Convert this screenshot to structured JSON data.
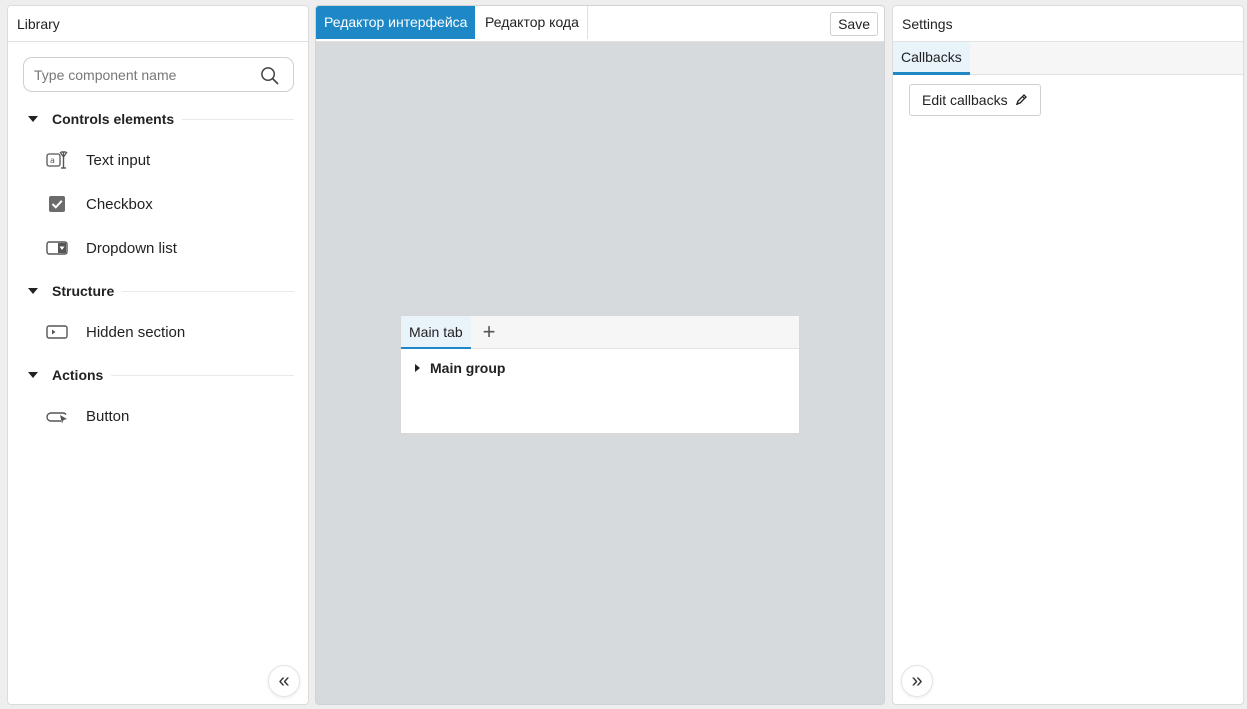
{
  "library": {
    "title": "Library",
    "search": {
      "placeholder": "Type component name",
      "value": ""
    },
    "groups": [
      {
        "title": "Controls elements",
        "items": [
          {
            "label": "Text input",
            "icon": "text-input-icon"
          },
          {
            "label": "Checkbox",
            "icon": "checkbox-icon"
          },
          {
            "label": "Dropdown list",
            "icon": "dropdown-icon"
          }
        ]
      },
      {
        "title": "Structure",
        "items": [
          {
            "label": "Hidden section",
            "icon": "hidden-section-icon"
          }
        ]
      },
      {
        "title": "Actions",
        "items": [
          {
            "label": "Button",
            "icon": "button-icon"
          }
        ]
      }
    ],
    "collapse_glyph": "«"
  },
  "editor": {
    "tabs": [
      {
        "label": "Редактор интерфейса",
        "active": true
      },
      {
        "label": "Редактор кода",
        "active": false
      }
    ],
    "save_label": "Save",
    "card": {
      "tab_label": "Main tab",
      "add_glyph": "+",
      "group_label": "Main group"
    }
  },
  "settings": {
    "title": "Settings",
    "tab_label": "Callbacks",
    "edit_callbacks_label": "Edit callbacks",
    "expand_glyph": "»"
  },
  "colors": {
    "accent": "#1e88c7",
    "canvas_bg": "#d7dadd",
    "page_bg": "#eeeeee"
  }
}
